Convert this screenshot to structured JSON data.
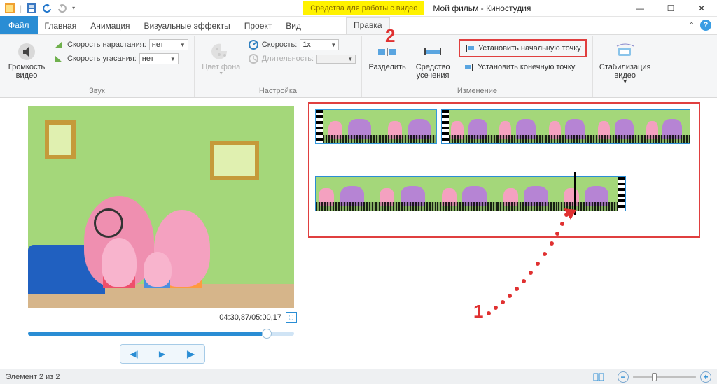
{
  "window": {
    "title": "Мой фильм - Киностудия",
    "context_tab": "Средства для работы с видео"
  },
  "tabs": {
    "file": "Файл",
    "home": "Главная",
    "animation": "Анимация",
    "visual_fx": "Визуальные эффекты",
    "project": "Проект",
    "view": "Вид",
    "edit": "Правка"
  },
  "ribbon": {
    "volume": "Громкость видео",
    "fade_in_label": "Скорость нарастания:",
    "fade_in_value": "нет",
    "fade_out_label": "Скорость угасания:",
    "fade_out_value": "нет",
    "group_sound": "Звук",
    "bg_color": "Цвет фона",
    "speed_label": "Скорость:",
    "speed_value": "1x",
    "duration_label": "Длительность:",
    "duration_value": "",
    "group_adjust": "Настройка",
    "split": "Разделить",
    "trim_tool": "Средство усечения",
    "set_start": "Установить начальную точку",
    "set_end": "Установить конечную точку",
    "group_change": "Изменение",
    "stabilize": "Стабилизация видео"
  },
  "preview": {
    "time": "04:30,87/05:00,17"
  },
  "status": {
    "element": "Элемент 2 из 2"
  },
  "annotations": {
    "n1": "1",
    "n2": "2"
  }
}
